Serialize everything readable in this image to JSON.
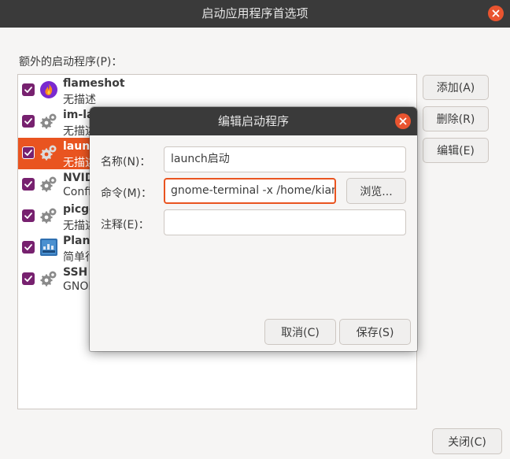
{
  "window": {
    "title": "启动应用程序首选项",
    "close_label": "close"
  },
  "list": {
    "label": "额外的启动程序(P)：",
    "items": [
      {
        "name": "flameshot",
        "desc": "无描述",
        "checked": true,
        "selected": false,
        "icon": "flameshot-icon"
      },
      {
        "name": "im-la",
        "desc": "无描述",
        "checked": true,
        "selected": false,
        "icon": "gears-icon"
      },
      {
        "name": "launc",
        "desc": "无描述",
        "checked": true,
        "selected": true,
        "icon": "gears-icon"
      },
      {
        "name": "NVID",
        "desc": "Confi",
        "checked": true,
        "selected": false,
        "icon": "gears-icon"
      },
      {
        "name": "picgo",
        "desc": "无描述",
        "checked": true,
        "selected": false,
        "icon": "gears-icon"
      },
      {
        "name": "Plank",
        "desc": "简单行",
        "checked": true,
        "selected": false,
        "icon": "plank-icon"
      },
      {
        "name": "SSH",
        "desc": "GNOM",
        "checked": true,
        "selected": false,
        "icon": "gears-icon"
      }
    ]
  },
  "buttons": {
    "add": "添加(A)",
    "remove": "删除(R)",
    "edit": "编辑(E)",
    "close": "关闭(C)"
  },
  "dialog": {
    "title": "编辑启动程序",
    "name_label": "名称(N)：",
    "name_value": "launch启动",
    "command_label": "命令(M)：",
    "command_value": "gnome-terminal -x /home/kian",
    "browse": "浏览...",
    "comment_label": "注释(E)：",
    "comment_value": "",
    "cancel": "取消(C)",
    "save": "保存(S)"
  },
  "colors": {
    "accent": "#e95420",
    "checkbox": "#77216f",
    "header": "#3a3a3a"
  }
}
